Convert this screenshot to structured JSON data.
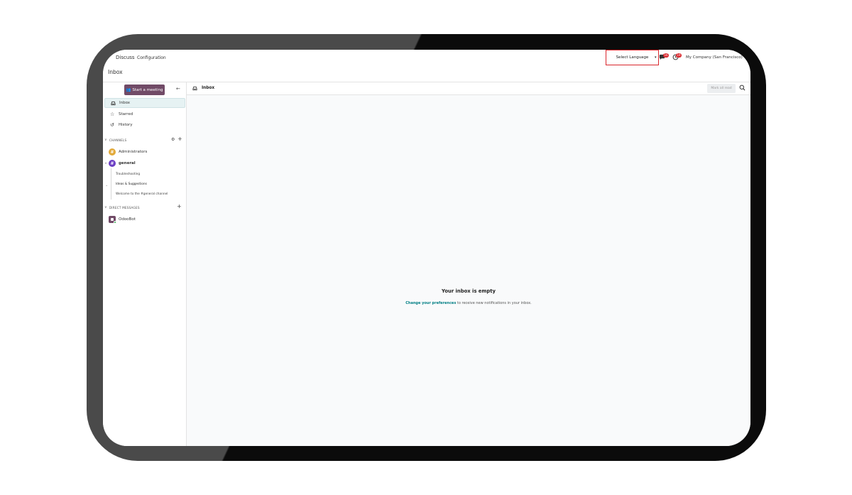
{
  "topbar": {
    "app_name": "Discuss",
    "menu_configuration": "Configuration",
    "language_select": "Select Language",
    "chat_badge": "16",
    "activity_badge": "19",
    "company": "My Company (San Francisco)"
  },
  "page": {
    "title": "Inbox"
  },
  "sidebar": {
    "start_meeting": "Start a meeting",
    "nav": [
      {
        "label": "Inbox",
        "icon": "inbox-icon",
        "active": true
      },
      {
        "label": "Starred",
        "icon": "star-icon",
        "active": false
      },
      {
        "label": "History",
        "icon": "history-icon",
        "active": false
      }
    ],
    "channels_header": "CHANNELS",
    "channels": [
      {
        "label": "Administrators",
        "avatar": "#"
      },
      {
        "label": "general",
        "avatar": "#"
      }
    ],
    "threads": [
      "Troubleshooting",
      "Ideas & Suggestions",
      "Welcome to the #general channel"
    ],
    "dm_header": "DIRECT MESSAGES",
    "direct_messages": [
      {
        "label": "OdooBot"
      }
    ]
  },
  "main": {
    "title": "Inbox",
    "mark_all_read": "Mark all read",
    "empty_title": "Your inbox is empty",
    "empty_link": "Change your preferences",
    "empty_text": " to receive new notifications in your inbox."
  },
  "colors": {
    "brand": "#714b67",
    "badge": "#d9262c",
    "link": "#017e84",
    "highlight_border": "#d9262c"
  }
}
